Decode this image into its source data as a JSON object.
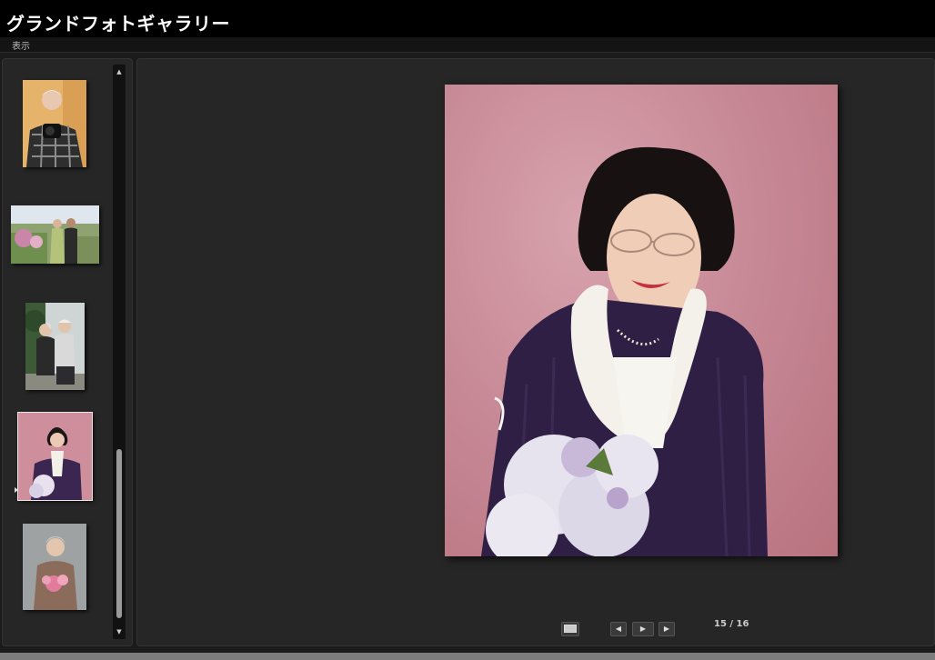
{
  "app": {
    "title": "グランドフォトギャラリー"
  },
  "menu": {
    "items": [
      "表示"
    ]
  },
  "thumbnails": [
    {
      "alt": "man-with-camera"
    },
    {
      "alt": "couple-outdoors"
    },
    {
      "alt": "couple-garden"
    },
    {
      "alt": "woman-pink-background",
      "selected": true
    },
    {
      "alt": "woman-with-flowers"
    }
  ],
  "viewer": {
    "counter": "15 / 16",
    "controls": {
      "fullscreen": "fullscreen-icon",
      "prev": "prev-icon",
      "play": "play-icon",
      "next": "next-icon"
    }
  },
  "colors": {
    "background": "#1b1b1b",
    "panel": "#262626",
    "titlebar": "#000000"
  }
}
